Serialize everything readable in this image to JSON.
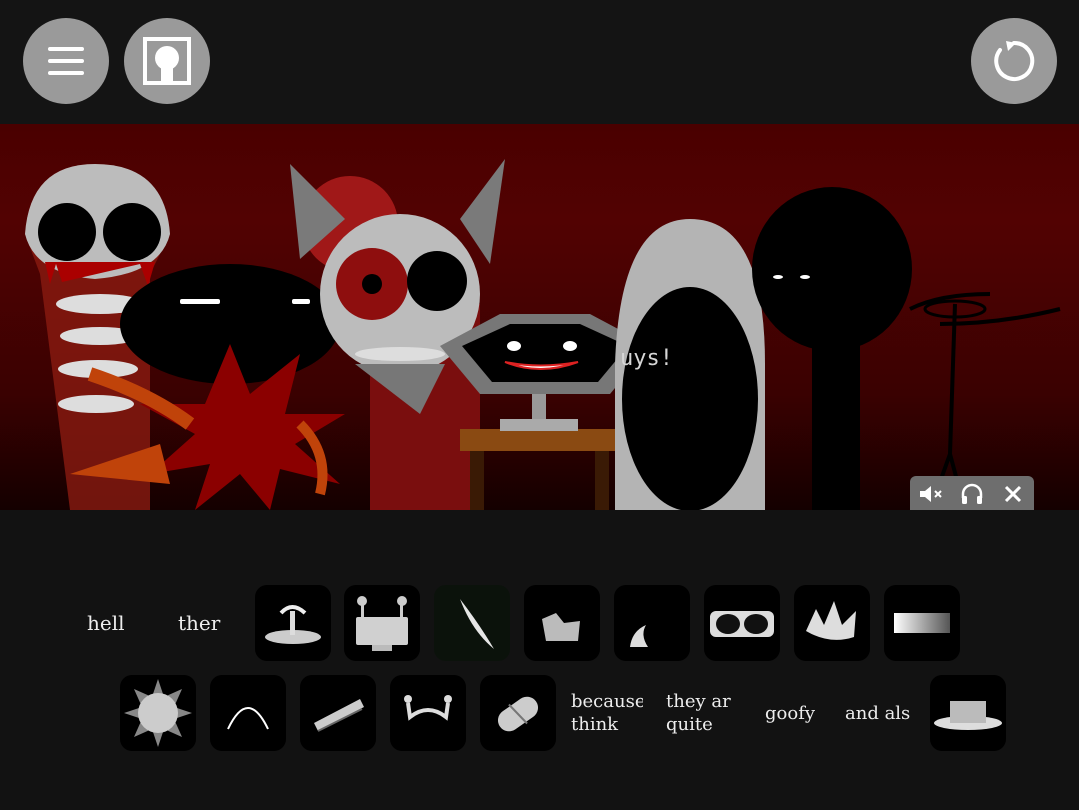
{
  "toolbar": {
    "menu_icon": "hamburger-icon",
    "character_icon": "character-select-icon",
    "reset_icon": "restart-icon"
  },
  "stage": {
    "speech_text": "uys!",
    "controls": [
      "mute-icon",
      "headphones-icon",
      "close-icon"
    ]
  },
  "tray": {
    "row1_words": [
      "hell",
      "ther"
    ],
    "row2_words": [
      {
        "line1": "because",
        "line2": "think"
      },
      {
        "line1": "they ar",
        "line2": "quite"
      },
      {
        "line1": "goofy",
        "line2": ""
      },
      {
        "line1": "and als",
        "line2": ""
      }
    ]
  },
  "colors": {
    "button_gray": "#9a9a9a",
    "stage_red": "#520202",
    "blood_red": "#8b0000",
    "tray_bg": "#121212"
  }
}
